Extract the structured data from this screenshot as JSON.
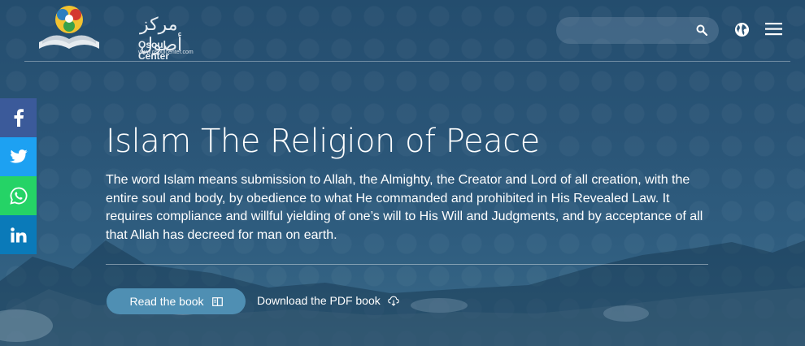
{
  "header": {
    "logo": {
      "arabic": "مركز أصول",
      "name": "Osoul Center",
      "url": "www.osoulcenter.com"
    },
    "search": {
      "placeholder": "",
      "value": ""
    },
    "icons": [
      "search-icon",
      "globe-icon",
      "menu-icon"
    ]
  },
  "social": [
    {
      "name": "facebook",
      "glyph": "f",
      "color": "#3b5a9a"
    },
    {
      "name": "twitter",
      "glyph": "",
      "color": "#1da1f2"
    },
    {
      "name": "whatsapp",
      "glyph": "",
      "color": "#25d366"
    },
    {
      "name": "linkedin",
      "glyph": "in",
      "color": "#0a7ab9"
    }
  ],
  "main": {
    "title": "Islam The Religion of Peace",
    "description": "The word Islam means submission to Allah, the Almighty, the Creator and Lord of all creation, with the entire soul and body, by obedience to what He commanded and prohibited in His Revealed Law. It requires compliance and willful yielding of one’s will to His Will and Judgments, and by acceptance of all that Allah has decreed for man on earth.",
    "read_button": "Read the book",
    "pdf_link": "Download the PDF book"
  },
  "colors": {
    "accent_button": "#4f8fb3",
    "background": "#2a5577"
  }
}
